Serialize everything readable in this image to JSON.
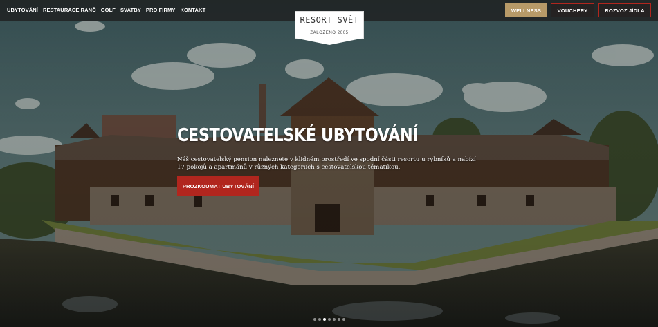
{
  "nav": {
    "items": [
      "UBYTOVÁNÍ",
      "RESTAURACE RANČ",
      "GOLF",
      "SVATBY",
      "PRO FIRMY",
      "KONTAKT"
    ]
  },
  "logo": {
    "title": "RESORT SVĚT",
    "subtitle": "ZALOŽENO 2005"
  },
  "buttons": {
    "wellness": "WELLNESS",
    "vouchery": "VOUCHERY",
    "rozvoz": "ROZVOZ JÍDLA"
  },
  "hero": {
    "headline": "CESTOVATELSKÉ UBYTOVÁNÍ",
    "description": "Náš cestovatelský pension naleznete v klidném prostředí ve spodní části resortu u rybníků a nabízí 17 pokojů a apartmánů v různých kategoriích s cestovatelskou tématikou.",
    "cta": "PROZKOUMAT UBYTOVÁNÍ"
  },
  "slider": {
    "count": 7,
    "active_index": 2
  },
  "colors": {
    "accent_red": "#b1261e",
    "wellness_gold": "#b79a68"
  }
}
